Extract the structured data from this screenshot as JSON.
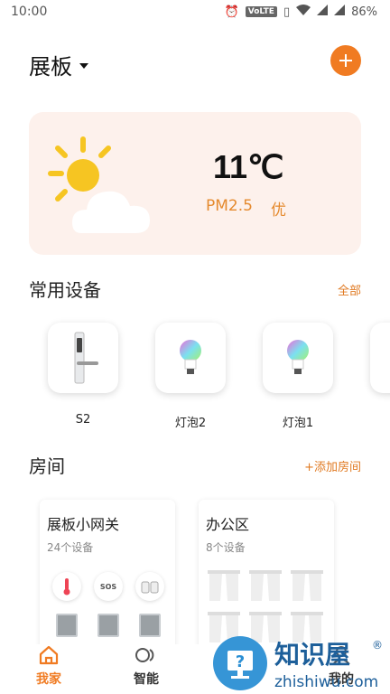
{
  "status": {
    "time": "10:00",
    "volte": "VoLTE",
    "battery": "86%"
  },
  "header": {
    "home_name": "展板"
  },
  "weather": {
    "temperature": "11℃",
    "pm_label": "PM2.5",
    "pm_quality": "优"
  },
  "devices_section": {
    "title": "常用设备",
    "all_link": "全部",
    "items": [
      {
        "label": "S2",
        "icon": "door-lock-icon"
      },
      {
        "label": "灯泡2",
        "icon": "bulb-icon"
      },
      {
        "label": "灯泡1",
        "icon": "bulb-icon"
      }
    ]
  },
  "rooms_section": {
    "title": "房间",
    "add_link": "+添加房间",
    "rooms": [
      {
        "name": "展板小网关",
        "count": "24个设备"
      },
      {
        "name": "办公区",
        "count": "8个设备"
      }
    ]
  },
  "nav": {
    "items": [
      {
        "label": "我家",
        "icon": "home-icon",
        "active": true
      },
      {
        "label": "智能",
        "icon": "smart-icon",
        "active": false
      },
      {
        "label": "我的",
        "icon": "profile-icon",
        "active": false
      }
    ]
  },
  "watermark": {
    "brand": "知识屋",
    "domain": "zhishiwu.com",
    "mark": "®"
  },
  "colors": {
    "accent": "#f07b22",
    "weather_bg": "#fdf1ec",
    "pm_text": "#e58a2e"
  }
}
